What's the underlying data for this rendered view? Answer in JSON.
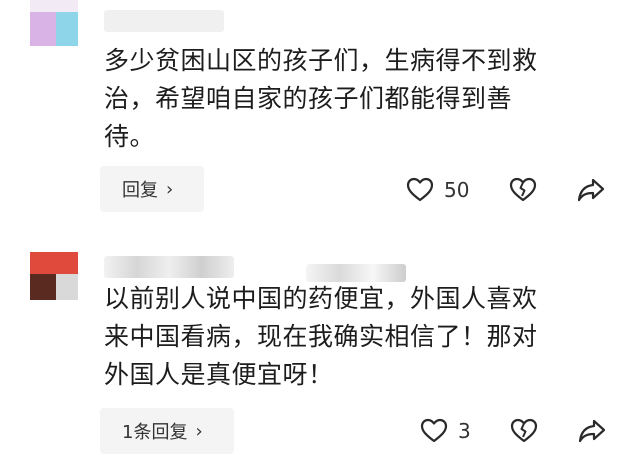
{
  "comments": [
    {
      "text": "多少贫困山区的孩子们，生病得不到救\n治，希望咱自家的孩子们都能得到善\n待。",
      "reply_label": "回复",
      "like_count": "50"
    },
    {
      "text": "以前别人说中国的药便宜，外国人喜欢\n来中国看病，现在我确实相信了！那对\n外国人是真便宜呀！",
      "reply_label": "1条回复",
      "like_count": "3"
    }
  ],
  "icons": {
    "like": "heart-icon",
    "dislike": "broken-heart-icon",
    "share": "share-arrow-icon",
    "chevron": "chevron-right-icon"
  }
}
